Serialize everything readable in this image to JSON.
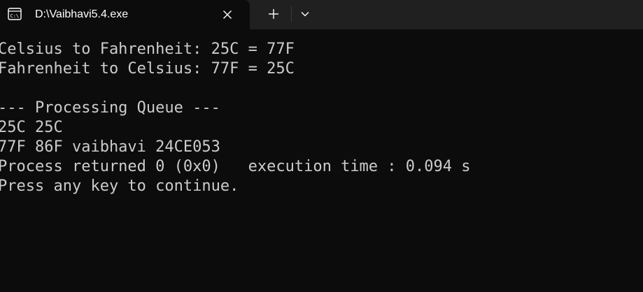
{
  "window": {
    "tab_title": "D:\\Vaibhavi5.4.exe",
    "tab_icon": "console-icon"
  },
  "console": {
    "lines": [
      "Celsius to Fahrenheit: 25C = 77F",
      "Fahrenheit to Celsius: 77F = 25C",
      "",
      "--- Processing Queue ---",
      "25C 25C",
      "77F 86F vaibhavi 24CE053",
      "Process returned 0 (0x0)   execution time : 0.094 s",
      "Press any key to continue."
    ]
  },
  "colors": {
    "titlebar": "#202020",
    "console_bg": "#0c0c0c",
    "console_text": "#cccccc",
    "tab_text": "#ffffff"
  }
}
